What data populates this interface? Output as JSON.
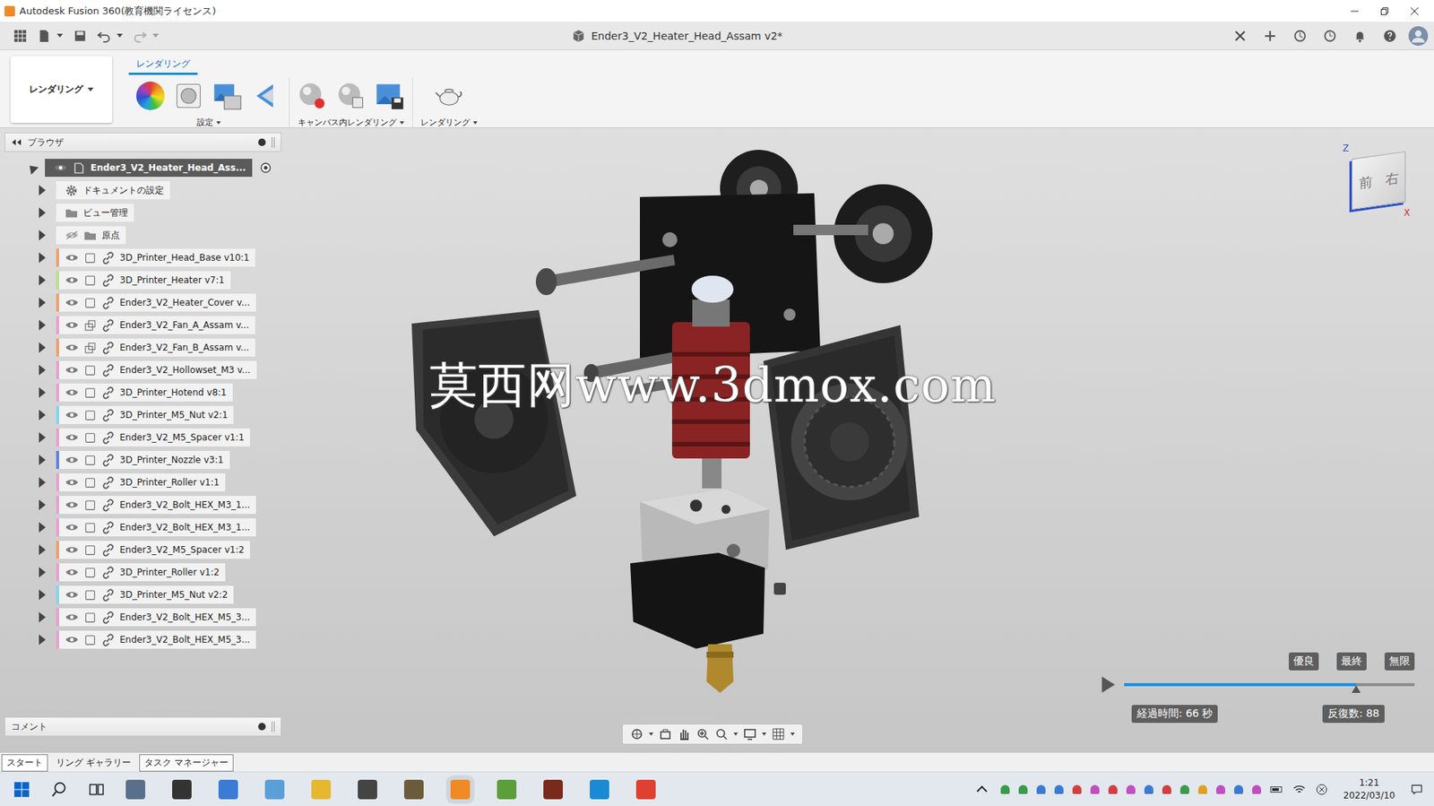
{
  "window": {
    "title": "Autodesk Fusion 360(教育機関ライセンス)"
  },
  "document_tab": {
    "title": "Ender3_V2_Heater_Head_Assam v2*"
  },
  "ribbon": {
    "workspace": "レンダリング",
    "tab": "レンダリング",
    "groups": [
      "設定",
      "キャンバス内レンダリング",
      "レンダリング"
    ]
  },
  "browser": {
    "title": "ブラウザ",
    "items": [
      {
        "label": "Ender3_V2_Heater_Head_Ass...",
        "kind": "root",
        "expanded": true,
        "visible": true
      },
      {
        "label": "ドキュメントの設定",
        "kind": "settings",
        "expanded": false
      },
      {
        "label": "ビュー管理",
        "kind": "folder",
        "expanded": false
      },
      {
        "label": "原点",
        "kind": "folder",
        "expanded": false,
        "visible": false
      },
      {
        "label": "3D_Printer_Head_Base v10:1",
        "kind": "component",
        "expanded": false,
        "visible": true,
        "color": "#f0a070"
      },
      {
        "label": "3D_Printer_Heater v7:1",
        "kind": "component",
        "expanded": false,
        "visible": true,
        "color": "#b8e08a"
      },
      {
        "label": "Ender3_V2_Heater_Cover v...",
        "kind": "component",
        "expanded": false,
        "visible": true,
        "color": "#f0a070"
      },
      {
        "label": "Ender3_V2_Fan_A_Assam v...",
        "kind": "assembly",
        "expanded": false,
        "visible": true,
        "color": "#e8a0d0"
      },
      {
        "label": "Ender3_V2_Fan_B_Assam v...",
        "kind": "assembly",
        "expanded": false,
        "visible": true,
        "color": "#f0a070"
      },
      {
        "label": "Ender3_V2_Hollowset_M3 v...",
        "kind": "component",
        "expanded": false,
        "visible": true,
        "color": "#e8a0d0"
      },
      {
        "label": "3D_Printer_Hotend v8:1",
        "kind": "component",
        "expanded": false,
        "visible": true,
        "color": "#e8a0d0"
      },
      {
        "label": "3D_Printer_M5_Nut v2:1",
        "kind": "component",
        "expanded": false,
        "visible": true,
        "color": "#80d8e8"
      },
      {
        "label": "Ender3_V2_M5_Spacer v1:1",
        "kind": "component",
        "expanded": false,
        "visible": true,
        "color": "#e8a0d0"
      },
      {
        "label": "3D_Printer_Nozzle v3:1",
        "kind": "component",
        "expanded": false,
        "visible": true,
        "color": "#6080e0"
      },
      {
        "label": "3D_Printer_Roller v1:1",
        "kind": "component",
        "expanded": false,
        "visible": true,
        "color": "#e8a0d0"
      },
      {
        "label": "Ender3_V2_Bolt_HEX_M3_1...",
        "kind": "component",
        "expanded": false,
        "visible": true,
        "color": "#e8a0d0"
      },
      {
        "label": "Ender3_V2_Bolt_HEX_M3_1...",
        "kind": "component",
        "expanded": false,
        "visible": true,
        "color": "#e8a0d0"
      },
      {
        "label": "Ender3_V2_M5_Spacer v1:2",
        "kind": "component",
        "expanded": false,
        "visible": true,
        "color": "#f0a070"
      },
      {
        "label": "3D_Printer_Roller v1:2",
        "kind": "component",
        "expanded": false,
        "visible": true,
        "color": "#e8a0d0"
      },
      {
        "label": "3D_Printer_M5_Nut v2:2",
        "kind": "component",
        "expanded": false,
        "visible": true,
        "color": "#80d8e8"
      },
      {
        "label": "Ender3_V2_Bolt_HEX_M5_3...",
        "kind": "component",
        "expanded": false,
        "visible": true,
        "color": "#e8a0d0"
      },
      {
        "label": "Ender3_V2_Bolt_HEX_M5_3...",
        "kind": "component",
        "expanded": false,
        "visible": true,
        "color": "#e8a0d0"
      }
    ]
  },
  "comments": {
    "title": "コメント"
  },
  "viewcube": {
    "front": "前",
    "right": "右",
    "axis_z": "Z",
    "axis_x": "X"
  },
  "watermark": "莫西网www.3dmox.com",
  "render": {
    "marks": [
      "優良",
      "最終",
      "無限"
    ],
    "level": 0.8,
    "elapsed": "経過時間: 66 秒",
    "iterations": "反復数: 88"
  },
  "bottom_tabs": [
    {
      "label": "スタート",
      "selected": true
    },
    {
      "label": "リング ギャラリー",
      "selected": false
    },
    {
      "label": "タスク マネージャー",
      "selected": false
    }
  ],
  "taskbar": {
    "time": "1:21",
    "date": "2022/03/10"
  }
}
